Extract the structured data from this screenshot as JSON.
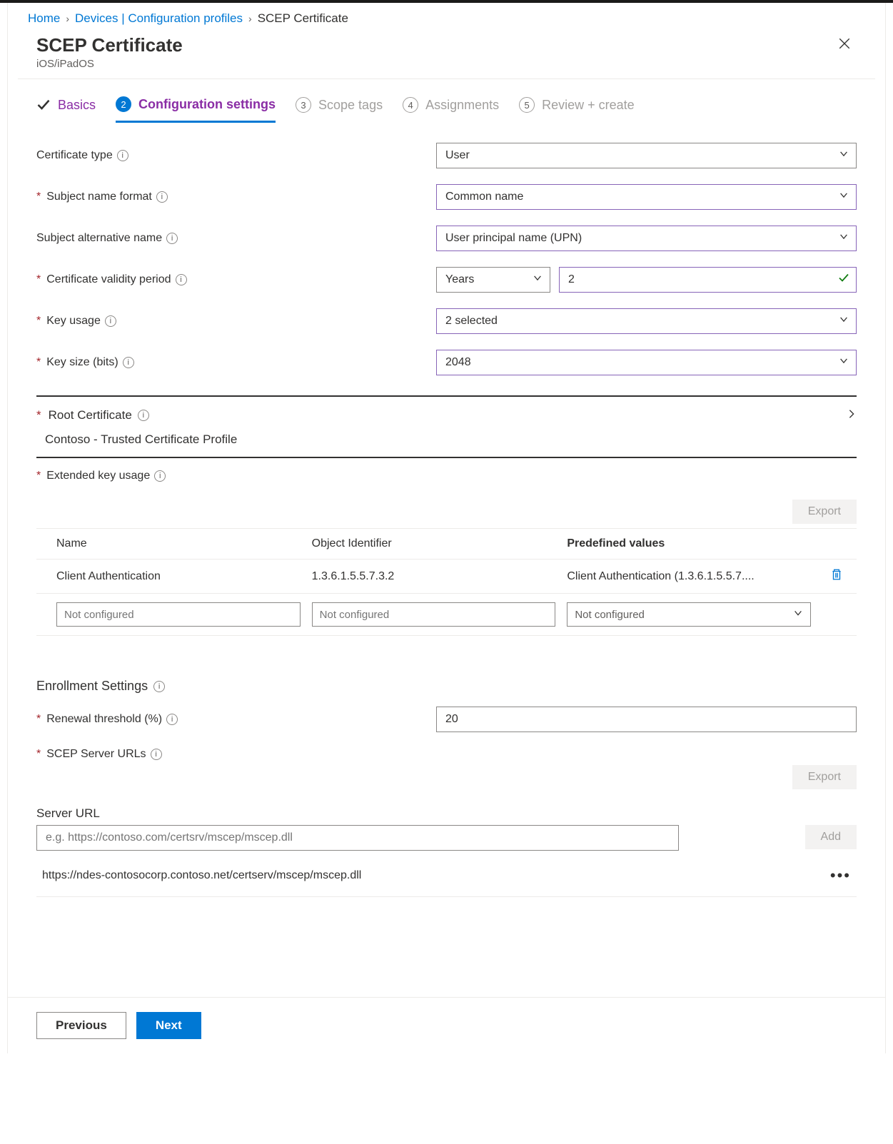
{
  "breadcrumb": {
    "home": "Home",
    "devices": "Devices | Configuration profiles",
    "current": "SCEP Certificate"
  },
  "header": {
    "title": "SCEP Certificate",
    "subtitle": "iOS/iPadOS"
  },
  "steps": {
    "s1": "Basics",
    "s2_num": "2",
    "s2": "Configuration settings",
    "s3_num": "3",
    "s3": "Scope tags",
    "s4_num": "4",
    "s4": "Assignments",
    "s5_num": "5",
    "s5": "Review + create"
  },
  "form": {
    "cert_type_label": "Certificate type",
    "cert_type_value": "User",
    "subject_name_label": "Subject name format",
    "subject_name_value": "Common name",
    "san_label": "Subject alternative name",
    "san_value": "User principal name (UPN)",
    "validity_label": "Certificate validity period",
    "validity_unit": "Years",
    "validity_value": "2",
    "key_usage_label": "Key usage",
    "key_usage_value": "2 selected",
    "key_size_label": "Key size (bits)",
    "key_size_value": "2048",
    "root_label": "Root Certificate",
    "root_value": "Contoso - Trusted Certificate Profile",
    "eku_label": "Extended key usage",
    "export_btn": "Export",
    "eku_cols": {
      "c1": "Name",
      "c2": "Object Identifier",
      "c3": "Predefined values"
    },
    "eku_row": {
      "name": "Client Authentication",
      "oid": "1.3.6.1.5.5.7.3.2",
      "pv": "Client Authentication (1.3.6.1.5.5.7...."
    },
    "not_configured": "Not configured",
    "enroll_title": "Enrollment Settings",
    "renewal_label": "Renewal threshold (%)",
    "renewal_value": "20",
    "scep_urls_label": "SCEP Server URLs",
    "server_url_label": "Server URL",
    "server_url_placeholder": "e.g. https://contoso.com/certsrv/mscep/mscep.dll",
    "add_btn": "Add",
    "url_value": "https://ndes-contosocorp.contoso.net/certserv/mscep/mscep.dll"
  },
  "footer": {
    "prev": "Previous",
    "next": "Next"
  }
}
